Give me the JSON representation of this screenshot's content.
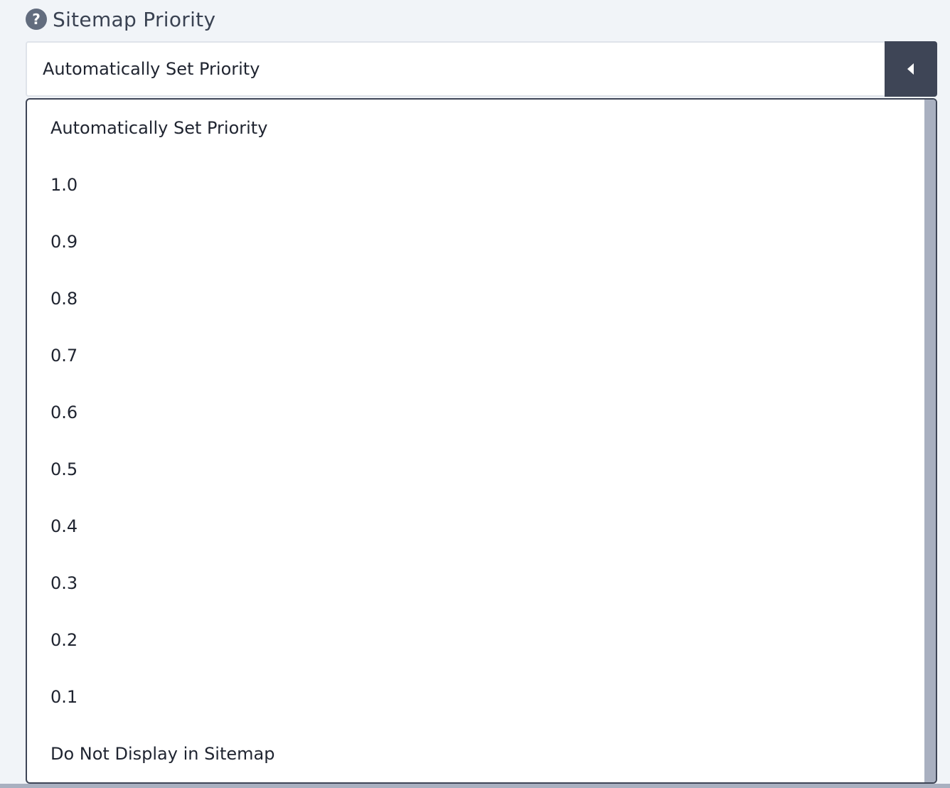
{
  "field": {
    "label": "Sitemap Priority",
    "help_icon": "question-circle-icon"
  },
  "select": {
    "value": "Automatically Set Priority",
    "toggle_icon": "caret-left-icon",
    "expanded": true
  },
  "options": [
    "Automatically Set Priority",
    "1.0",
    "0.9",
    "0.8",
    "0.7",
    "0.6",
    "0.5",
    "0.4",
    "0.3",
    "0.2",
    "0.1",
    "Do Not Display in Sitemap"
  ],
  "colors": {
    "background": "#f1f4f8",
    "toggle": "#3e4556",
    "help_icon": "#626c7e",
    "scrollbar": "#a9b0c0"
  }
}
